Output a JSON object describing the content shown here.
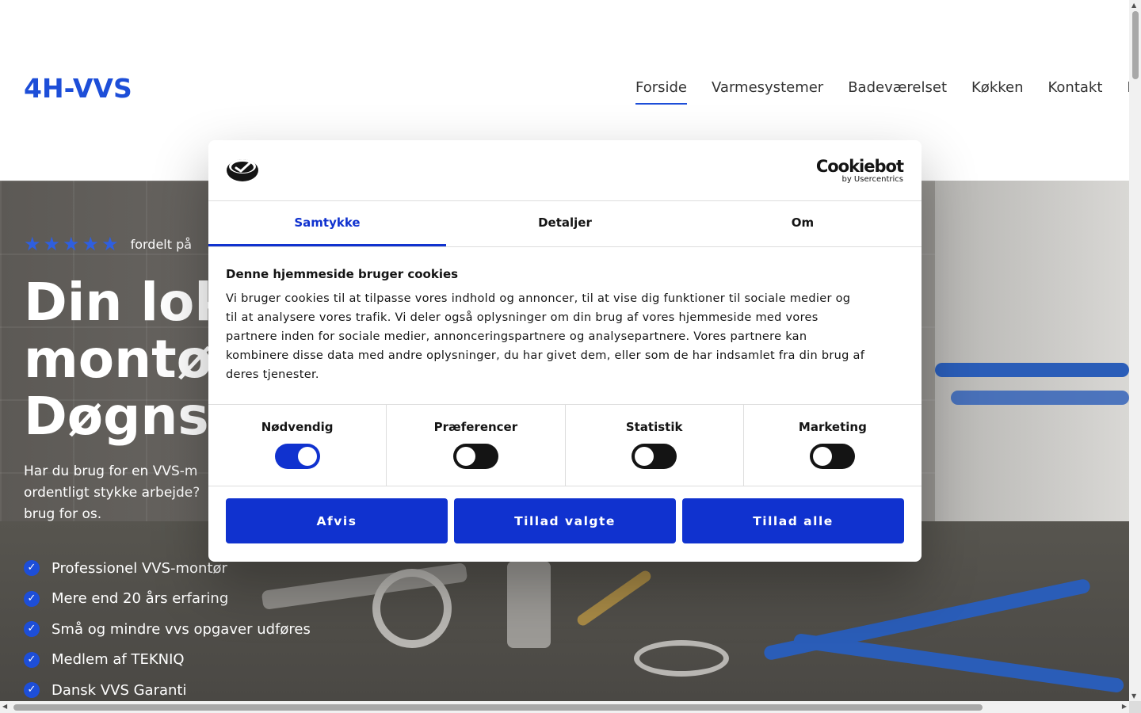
{
  "header": {
    "logo": "4H-VVS",
    "nav": [
      {
        "label": "Forside",
        "active": true
      },
      {
        "label": "Varmesystemer",
        "active": false
      },
      {
        "label": "Badeværelset",
        "active": false
      },
      {
        "label": "Køkken",
        "active": false
      },
      {
        "label": "Kontakt",
        "active": false
      },
      {
        "label": "E",
        "active": false
      }
    ]
  },
  "hero": {
    "rating_stars": 5,
    "rating_text": "fordelt på",
    "title_lines": [
      "Din lok",
      "montø",
      "Døgns"
    ],
    "description_lines": [
      "Har du brug for en VVS-m",
      "ordentligt stykke arbejde?",
      "brug for os."
    ],
    "features": [
      "Professionel VVS-montør",
      "Mere end 20 års erfaring",
      "Små og mindre vvs opgaver udføres",
      "Medlem af TEKNIQ",
      "Dansk VVS Garanti"
    ],
    "accent_color": "#1d4ed8"
  },
  "cookie_dialog": {
    "brand_main": "Cookiebot",
    "brand_sub": "by Usercentrics",
    "tabs": [
      {
        "label": "Samtykke",
        "active": true
      },
      {
        "label": "Detaljer",
        "active": false
      },
      {
        "label": "Om",
        "active": false
      }
    ],
    "heading": "Denne hjemmeside bruger cookies",
    "body_lines": [
      "Vi bruger cookies til at tilpasse vores indhold og annoncer, til at vise dig funktioner til sociale medier og",
      "til at analysere vores trafik. Vi deler også oplysninger om din brug af vores hjemmeside med vores",
      "partnere inden for sociale medier, annonceringspartnere og analysepartnere. Vores partnere kan",
      "kombinere disse data med andre oplysninger, du har givet dem, eller som de har indsamlet fra din brug af",
      "deres tjenester."
    ],
    "toggles": [
      {
        "label": "Nødvendig",
        "on": true
      },
      {
        "label": "Præferencer",
        "on": false
      },
      {
        "label": "Statistik",
        "on": false
      },
      {
        "label": "Marketing",
        "on": false
      }
    ],
    "buttons": {
      "reject": "Afvis",
      "allow_selected": "Tillad valgte",
      "allow_all": "Tillad alle"
    },
    "accent_color": "#1032cf"
  },
  "icons": {
    "star": "star-icon",
    "check": "check-circle-icon",
    "cookiebot_logo": "cookiebot-logo-icon"
  }
}
